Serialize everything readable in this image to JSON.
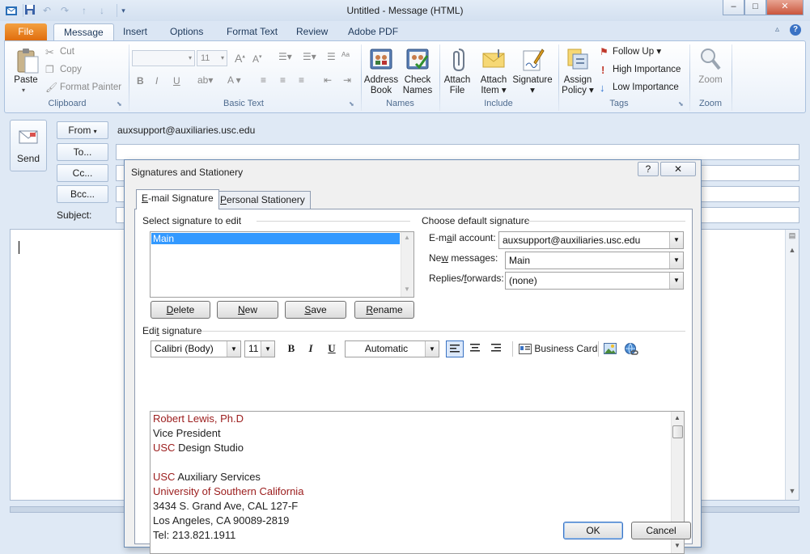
{
  "window": {
    "title": "Untitled  -  Message (HTML)",
    "controls": {
      "minimize": "–",
      "maximize": "□",
      "close": "✕"
    }
  },
  "ribbon": {
    "tabs": [
      "File",
      "Message",
      "Insert",
      "Options",
      "Format Text",
      "Review",
      "Adobe PDF"
    ],
    "active_tab": "Message",
    "groups": {
      "clipboard": {
        "label": "Clipboard",
        "paste": "Paste",
        "cut": "Cut",
        "copy": "Copy",
        "format_painter": "Format Painter"
      },
      "basic_text": {
        "label": "Basic Text",
        "font_size": "11"
      },
      "names": {
        "label": "Names",
        "address_book": [
          "Address",
          "Book"
        ],
        "check_names": [
          "Check",
          "Names"
        ]
      },
      "include": {
        "label": "Include",
        "attach_file": [
          "Attach",
          "File"
        ],
        "attach_item": [
          "Attach",
          "Item"
        ],
        "signature": "Signature"
      },
      "tags": {
        "label": "Tags",
        "assign_policy": [
          "Assign",
          "Policy"
        ],
        "follow_up": "Follow Up",
        "high_importance": "High Importance",
        "low_importance": "Low Importance"
      },
      "zoom": {
        "label": "Zoom",
        "zoom": "Zoom"
      }
    }
  },
  "message": {
    "send": "Send",
    "from_button": "From",
    "from_value": "auxsupport@auxiliaries.usc.edu",
    "to_button": "To...",
    "cc_button": "Cc...",
    "bcc_button": "Bcc...",
    "subject_label": "Subject:"
  },
  "dialog": {
    "title": "Signatures and Stationery",
    "help": "?",
    "close": "✕",
    "tabs": [
      "E-mail Signature",
      "Personal Stationery"
    ],
    "active_tab": "E-mail Signature",
    "select_label": "Select signature to edit",
    "signatures": [
      "Main"
    ],
    "selected_signature": "Main",
    "buttons": {
      "delete": "Delete",
      "new": "New",
      "save": "Save",
      "rename": "Rename",
      "ok": "OK",
      "cancel": "Cancel"
    },
    "default_section": "Choose default signature",
    "email_account_label": "E-mail account:",
    "email_account_value": "auxsupport@auxiliaries.usc.edu",
    "new_messages_label": "New messages:",
    "new_messages_value": "Main",
    "replies_label": "Replies/forwards:",
    "replies_value": "(none)",
    "edit_label": "Edit signature",
    "font": "Calibri (Body)",
    "font_size": "11",
    "bold": "B",
    "italic": "I",
    "underline": "U",
    "color": "Automatic",
    "business_card": "Business Card",
    "signature_lines": [
      {
        "text": "Robert Lewis, Ph.D",
        "color": "#9b1c1c"
      },
      {
        "text": "Vice President",
        "color": "#222222"
      },
      {
        "text": "USC Design Studio",
        "color": "#9b1c1c",
        "prefix": "USC",
        "rest": " Design Studio"
      },
      {
        "text": "",
        "color": "#222222"
      },
      {
        "text": "USC Auxiliary Services",
        "color": "#9b1c1c",
        "prefix": "USC",
        "rest": " Auxiliary Services"
      },
      {
        "text": "University of Southern California",
        "color": "#9b1c1c"
      },
      {
        "text": "3434 S. Grand Ave, CAL 127-F",
        "color": "#222222"
      },
      {
        "text": "Los Angeles, CA 90089-2819",
        "color": "#222222"
      },
      {
        "text": "Tel: 213.821.1911",
        "color": "#222222"
      }
    ]
  },
  "colors": {
    "file_tab": "#e06d0e",
    "ribbon_border": "#aac1de",
    "selection": "#3399ff",
    "usc_cardinal": "#9b1c1c"
  }
}
